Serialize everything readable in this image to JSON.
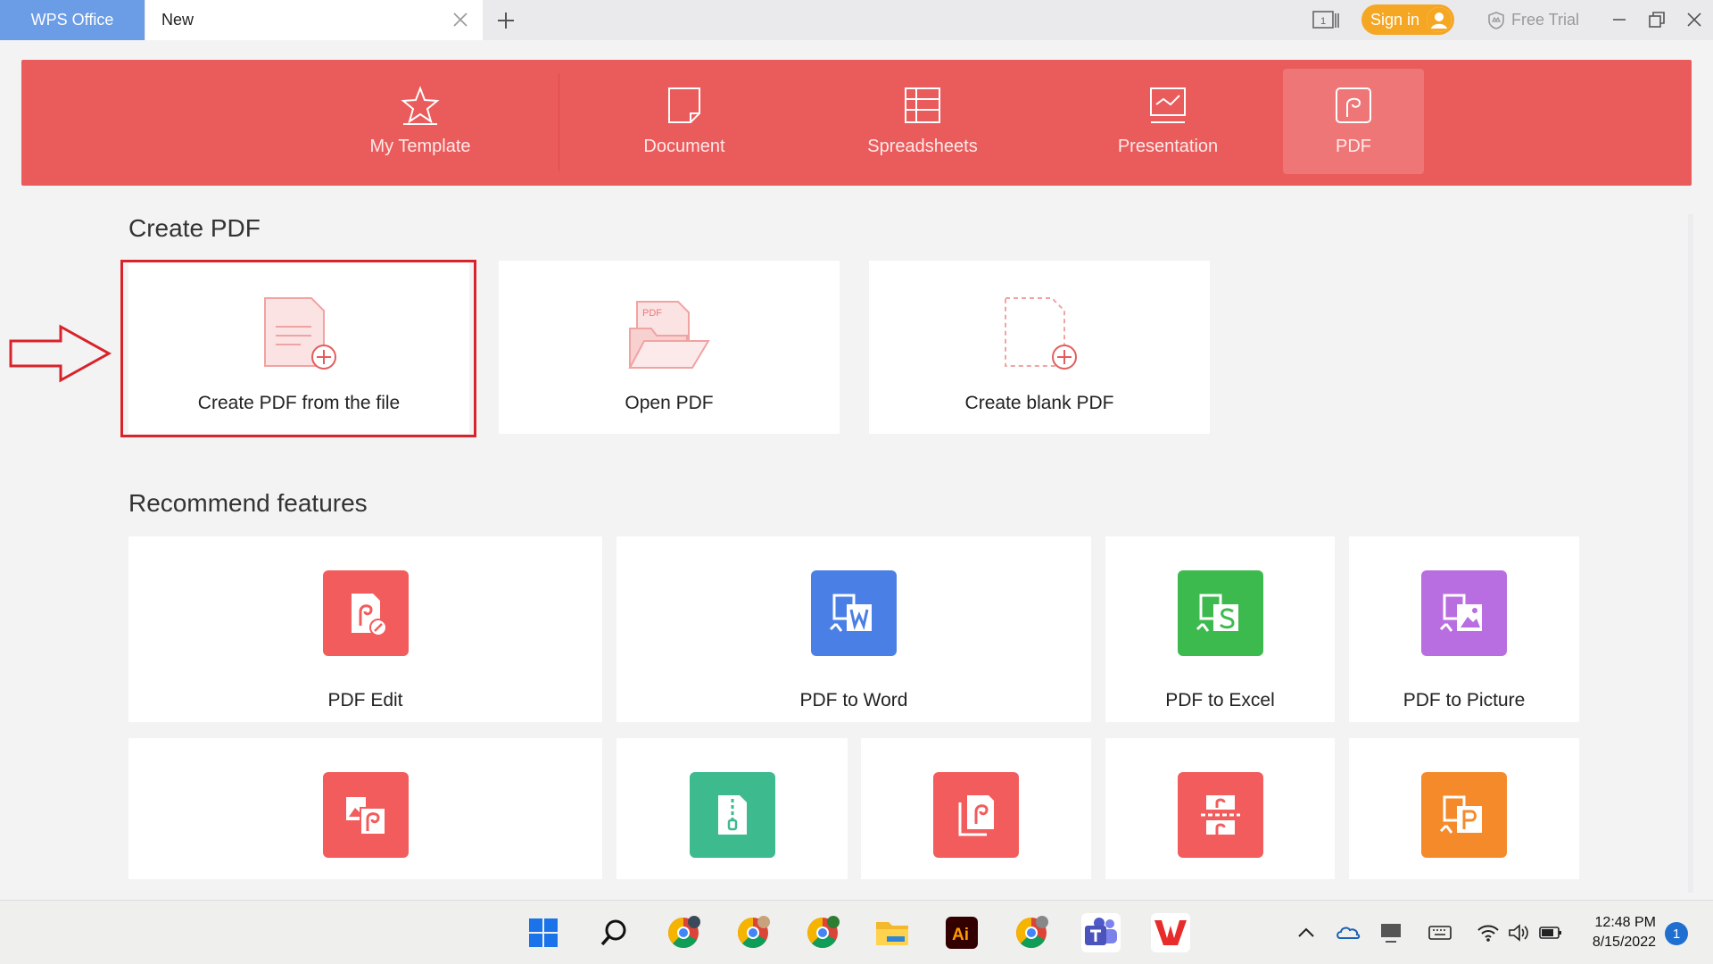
{
  "titlebar": {
    "app_name": "WPS Office",
    "tab_title": "New",
    "signin_label": "Sign in",
    "free_trial_label": "Free Trial"
  },
  "categories": [
    {
      "label": "My Template",
      "icon": "star-icon"
    },
    {
      "label": "Document",
      "icon": "document-icon"
    },
    {
      "label": "Spreadsheets",
      "icon": "spreadsheet-icon"
    },
    {
      "label": "Presentation",
      "icon": "presentation-icon"
    },
    {
      "label": "PDF",
      "icon": "pdf-icon",
      "active": true
    }
  ],
  "create_section": {
    "title": "Create PDF",
    "cards": [
      {
        "label": "Create PDF from the file",
        "icon": "file-plus-icon"
      },
      {
        "label": "Open PDF",
        "icon": "pdf-folder-icon",
        "badge": "PDF"
      },
      {
        "label": "Create blank PDF",
        "icon": "blank-file-plus-icon"
      }
    ]
  },
  "recommend_section": {
    "title": "Recommend features",
    "row1": [
      {
        "label": "PDF Edit",
        "color": "#f25c5c",
        "icon": "pdf-edit-icon"
      },
      {
        "label": "PDF to Word",
        "color": "#4a7fe6",
        "icon": "pdf-to-word-icon"
      },
      {
        "label": "PDF to Excel",
        "color": "#3dba4e",
        "icon": "pdf-to-excel-icon"
      },
      {
        "label": "PDF to Picture",
        "color": "#b86ee0",
        "icon": "pdf-to-picture-icon"
      }
    ],
    "row2": [
      {
        "color": "#f25c5c",
        "icon": "picture-to-pdf-icon"
      },
      {
        "color": "#3dba8e",
        "icon": "pdf-compress-icon"
      },
      {
        "color": "#f25c5c",
        "icon": "pdf-merge-icon"
      },
      {
        "color": "#f25c5c",
        "icon": "pdf-split-icon"
      },
      {
        "color": "#f58a2a",
        "icon": "pdf-to-ppt-icon"
      }
    ]
  },
  "taskbar": {
    "time": "12:48 PM",
    "date": "8/15/2022",
    "notification_count": "1",
    "ai_label": "Ai"
  },
  "colors": {
    "accent": "#ea5b5c",
    "highlight": "#d8232a",
    "signin": "#f5a623"
  }
}
